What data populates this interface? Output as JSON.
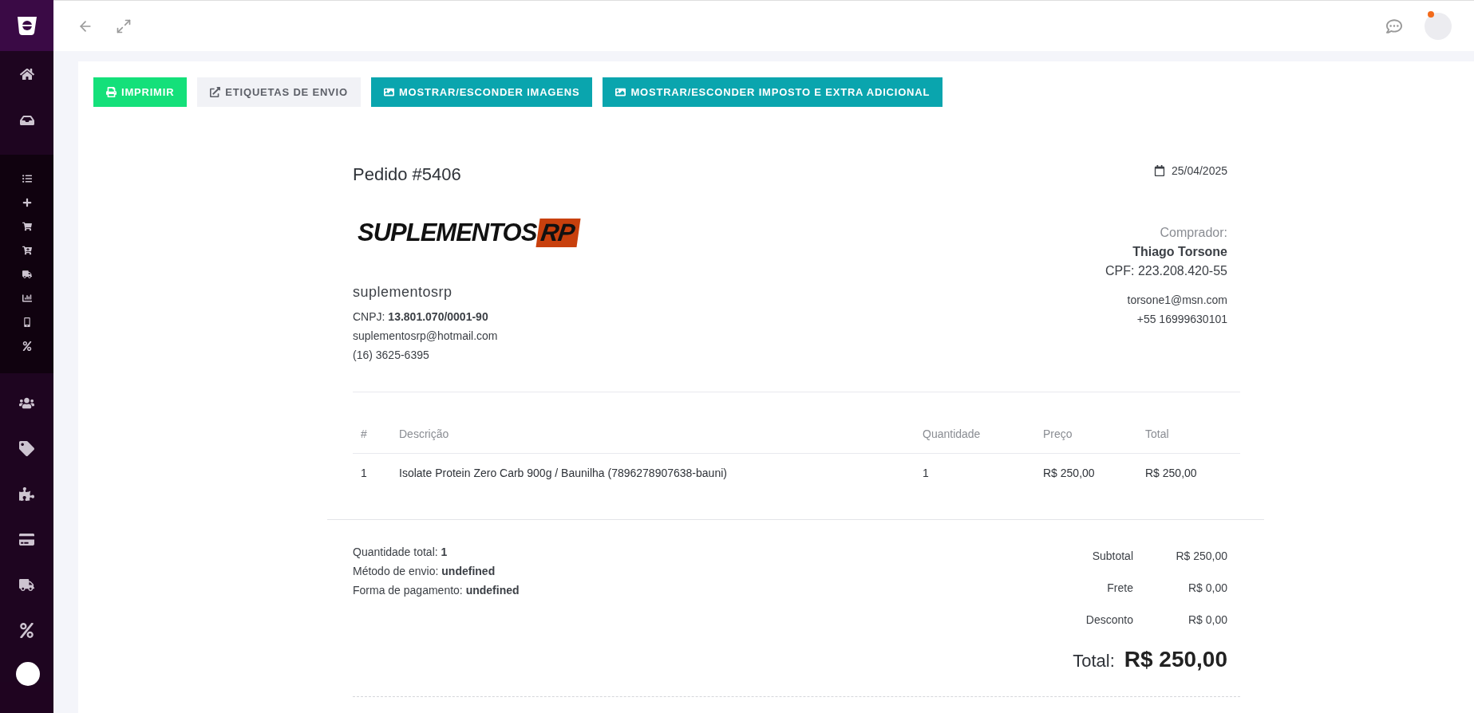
{
  "actions": [
    {
      "label": "IMPRIMIR",
      "kind": "success"
    },
    {
      "label": "ETIQUETAS DE ENVIO",
      "kind": "light"
    },
    {
      "label": "MOSTRAR/ESCONDER IMAGENS",
      "kind": "info"
    },
    {
      "label": "MOSTRAR/ESCONDER IMPOSTO E EXTRA ADICIONAL",
      "kind": "info"
    }
  ],
  "order": {
    "title": "Pedido #5406",
    "date": "25/04/2025"
  },
  "store": {
    "logo_word": "SUPLEMENTOS",
    "logo_badge": "RP",
    "name": "suplementosrp",
    "cnpj_label": "CNPJ:",
    "cnpj": "13.801.070/0001-90",
    "email": "suplementosrp@hotmail.com",
    "phone": "(16) 3625-6395"
  },
  "buyer": {
    "label": "Comprador:",
    "name": "Thiago Torsone",
    "cpf": "CPF: 223.208.420-55",
    "email": "torsone1@msn.com",
    "phone": "+55 16999630101"
  },
  "table": {
    "columns": [
      "#",
      "Descrição",
      "Quantidade",
      "Preço",
      "Total"
    ],
    "rows": [
      [
        "1",
        "Isolate Protein Zero Carb 900g / Baunilha (7896278907638-bauni)",
        "1",
        "R$ 250,00",
        "R$ 250,00"
      ]
    ]
  },
  "summary": [
    {
      "label": "Quantidade total:",
      "value": "1"
    },
    {
      "label": "Método de envio:",
      "value": "undefined"
    },
    {
      "label": "Forma de pagamento:",
      "value": "undefined"
    }
  ],
  "totals": [
    {
      "label": "Subtotal",
      "value": "R$ 250,00"
    },
    {
      "label": "Frete",
      "value": "R$ 0,00"
    },
    {
      "label": "Desconto",
      "value": "R$ 0,00"
    }
  ],
  "grand_total": {
    "label": "Total:",
    "value": "R$ 250,00"
  }
}
